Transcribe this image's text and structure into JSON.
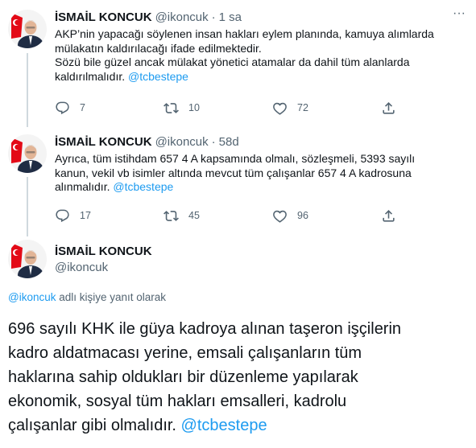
{
  "tweets": [
    {
      "name": "İSMAİL KONCUK",
      "handle": "@ikoncuk",
      "separator": "·",
      "time": "1 sa",
      "text_lines": [
        "AKP’nin yapacağı söylenen insan hakları eylem planında, kamuya alımlarda",
        "mülakatın kaldırılacağı ifade edilmektedir.",
        "Sözü bile güzel ancak mülakat yönetici atamalar da dahil tüm alanlarda",
        "kaldırılmalıdır."
      ],
      "mention": "@tcbestepe",
      "replies": "7",
      "retweets": "10",
      "likes": "72"
    },
    {
      "name": "İSMAİL KONCUK",
      "handle": "@ikoncuk",
      "separator": "·",
      "time": "58d",
      "text_lines": [
        "Ayrıca, tüm istihdam 657 4 A kapsamında olmalı, sözleşmeli, 5393 sayılı",
        "kanun, vekil vb isimler altında mevcut tüm çalışanlar 657 4 A kadrosuna",
        "alınmalıdır."
      ],
      "mention": "@tcbestepe",
      "replies": "17",
      "retweets": "45",
      "likes": "96"
    }
  ],
  "main": {
    "name": "İSMAİL KONCUK",
    "handle": "@ikoncuk",
    "reply_mention": "@ikoncuk",
    "reply_suffix": " adlı kişiye yanıt olarak",
    "text_lines": [
      "696 sayılı KHK ile güya kadroya alınan taşeron işçilerin",
      "kadro aldatmacası yerine, emsali çalışanların tüm",
      "haklarına sahip oldukları bir düzenleme yapılarak",
      "ekonomik, sosyal tüm hakları emsalleri, kadrolu",
      "çalışanlar gibi olmalıdır."
    ],
    "mention": "@tcbestepe"
  },
  "icons": {
    "reply": "reply-icon",
    "retweet": "retweet-icon",
    "like": "like-icon",
    "share": "share-icon",
    "more": "more-icon"
  },
  "colors": {
    "link": "#1d9bf0",
    "secondary": "#536471",
    "text": "#0f1419",
    "flag_red": "#e30a17"
  }
}
